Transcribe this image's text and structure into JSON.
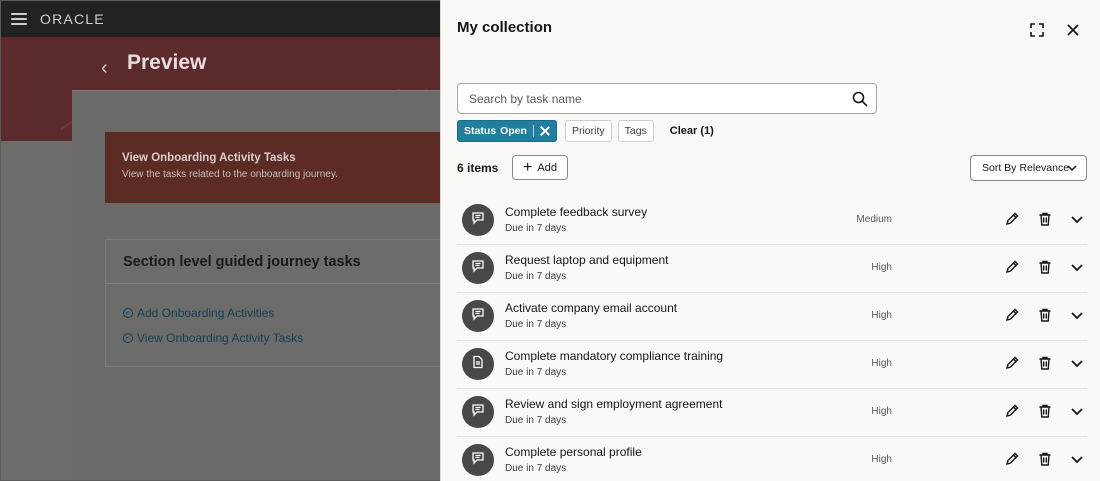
{
  "app": {
    "logo_text": "ORACLE"
  },
  "background": {
    "page_title": "Preview",
    "activity_card": {
      "title": "View Onboarding Activity Tasks",
      "subtitle": "View the tasks related to the onboarding journey."
    },
    "section": {
      "title": "Section level guided journey tasks",
      "links": [
        {
          "label": "Add Onboarding Activities"
        },
        {
          "label": "View Onboarding Activity Tasks"
        }
      ]
    }
  },
  "drawer": {
    "title": "My collection",
    "search": {
      "placeholder": "Search by task name",
      "value": ""
    },
    "filters": {
      "active_chip": {
        "label": "Status",
        "value": "Open"
      },
      "chips": [
        "Priority",
        "Tags"
      ],
      "clear_label": "Clear (1)"
    },
    "items_count": "6 items",
    "add_label": "Add",
    "sort": {
      "prefix": "Sort By",
      "value": "Relevance"
    },
    "tasks": [
      {
        "name": "Complete feedback survey",
        "due": "Due in 7 days",
        "priority": "Medium",
        "icon": "chat-icon"
      },
      {
        "name": "Request laptop and equipment",
        "due": "Due in 7 days",
        "priority": "High",
        "icon": "chat-icon"
      },
      {
        "name": "Activate company email account",
        "due": "Due in 7 days",
        "priority": "High",
        "icon": "chat-icon"
      },
      {
        "name": "Complete mandatory compliance training",
        "due": "Due in 7 days",
        "priority": "High",
        "icon": "document-icon"
      },
      {
        "name": "Review and sign employment agreement",
        "due": "Due in 7 days",
        "priority": "High",
        "icon": "chat-icon"
      },
      {
        "name": "Complete personal profile",
        "due": "Due in 7 days",
        "priority": "High",
        "icon": "chat-icon"
      }
    ]
  },
  "colors": {
    "accent_chip": "#227e9e",
    "banner": "#5b2a2c",
    "avatar": "#4a4745"
  }
}
